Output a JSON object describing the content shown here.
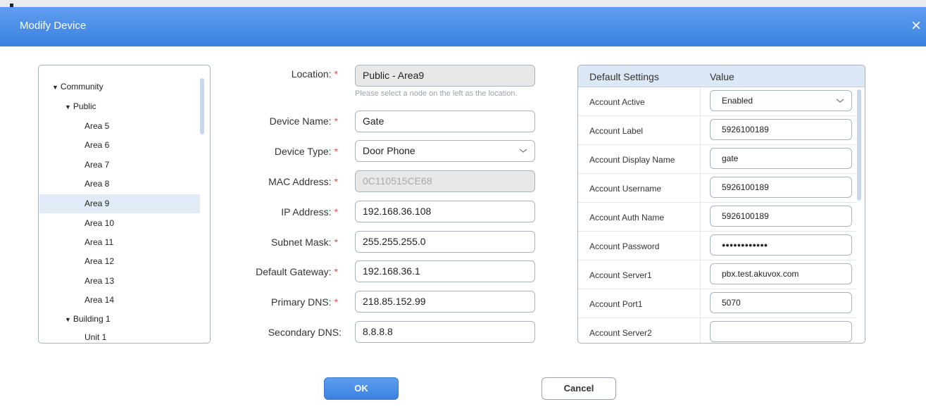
{
  "dialog": {
    "title": "Modify Device",
    "close_glyph": "×"
  },
  "tree": {
    "items": [
      {
        "label": "Community",
        "level": 0,
        "expanded": true
      },
      {
        "label": "Public",
        "level": 1,
        "expanded": true
      },
      {
        "label": "Area 5",
        "level": 2
      },
      {
        "label": "Area 6",
        "level": 2
      },
      {
        "label": "Area 7",
        "level": 2
      },
      {
        "label": "Area 8",
        "level": 2
      },
      {
        "label": "Area 9",
        "level": 2,
        "selected": true
      },
      {
        "label": "Area 10",
        "level": 2
      },
      {
        "label": "Area 11",
        "level": 2
      },
      {
        "label": "Area 12",
        "level": 2
      },
      {
        "label": "Area 13",
        "level": 2
      },
      {
        "label": "Area 14",
        "level": 2
      },
      {
        "label": "Building 1",
        "level": 1,
        "expanded": true
      },
      {
        "label": "Unit 1",
        "level": 2
      }
    ]
  },
  "form": {
    "location": {
      "label": "Location:",
      "value": "Public - Area9",
      "hint": "Please select a node on the left as the location."
    },
    "device_name": {
      "label": "Device Name:",
      "value": "Gate"
    },
    "device_type": {
      "label": "Device Type:",
      "value": "Door Phone"
    },
    "mac_address": {
      "label": "MAC Address:",
      "value": "0C110515CE68"
    },
    "ip_address": {
      "label": "IP Address:",
      "value": "192.168.36.108"
    },
    "subnet_mask": {
      "label": "Subnet Mask:",
      "value": "255.255.255.0"
    },
    "default_gateway": {
      "label": "Default Gateway:",
      "value": "192.168.36.1"
    },
    "primary_dns": {
      "label": "Primary DNS:",
      "value": "218.85.152.99"
    },
    "secondary_dns": {
      "label": "Secondary DNS:",
      "value": "8.8.8.8"
    },
    "required_marker": "*"
  },
  "settings": {
    "header": {
      "name": "Default Settings",
      "value": "Value"
    },
    "rows": [
      {
        "name": "Account Active",
        "value": "Enabled"
      },
      {
        "name": "Account Label",
        "value": "5926100189"
      },
      {
        "name": "Account Display Name",
        "value": "gate"
      },
      {
        "name": "Account Username",
        "value": "5926100189"
      },
      {
        "name": "Account Auth Name",
        "value": "5926100189"
      },
      {
        "name": "Account Password",
        "value": "●●●●●●●●●●●●"
      },
      {
        "name": "Account Server1",
        "value": "pbx.test.akuvox.com"
      },
      {
        "name": "Account Port1",
        "value": "5070"
      },
      {
        "name": "Account Server2",
        "value": ""
      }
    ]
  },
  "buttons": {
    "ok": "OK",
    "cancel": "Cancel"
  },
  "colors": {
    "accent": "#3b81e0",
    "required": "#e5534b"
  }
}
